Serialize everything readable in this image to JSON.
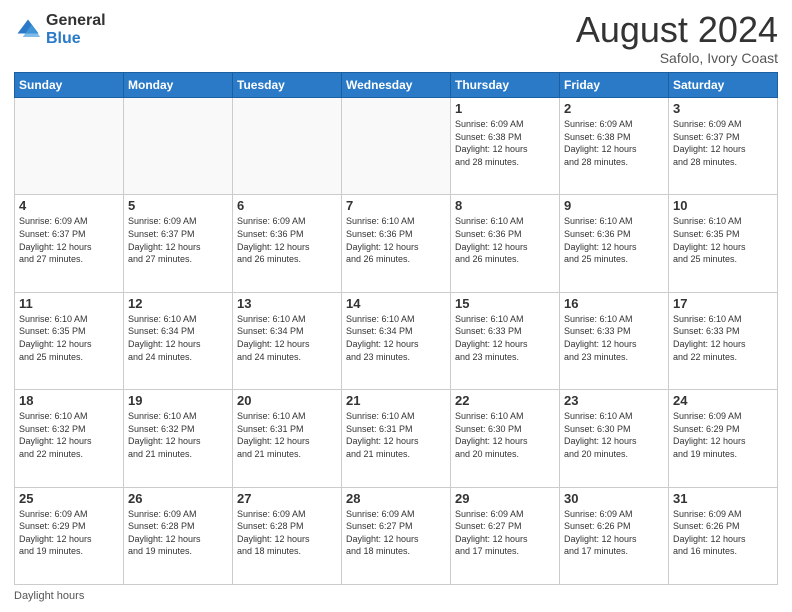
{
  "header": {
    "logo_general": "General",
    "logo_blue": "Blue",
    "month_title": "August 2024",
    "subtitle": "Safolo, Ivory Coast"
  },
  "footer": {
    "note": "Daylight hours"
  },
  "weekdays": [
    "Sunday",
    "Monday",
    "Tuesday",
    "Wednesday",
    "Thursday",
    "Friday",
    "Saturday"
  ],
  "weeks": [
    [
      {
        "day": "",
        "info": ""
      },
      {
        "day": "",
        "info": ""
      },
      {
        "day": "",
        "info": ""
      },
      {
        "day": "",
        "info": ""
      },
      {
        "day": "1",
        "info": "Sunrise: 6:09 AM\nSunset: 6:38 PM\nDaylight: 12 hours\nand 28 minutes."
      },
      {
        "day": "2",
        "info": "Sunrise: 6:09 AM\nSunset: 6:38 PM\nDaylight: 12 hours\nand 28 minutes."
      },
      {
        "day": "3",
        "info": "Sunrise: 6:09 AM\nSunset: 6:37 PM\nDaylight: 12 hours\nand 28 minutes."
      }
    ],
    [
      {
        "day": "4",
        "info": "Sunrise: 6:09 AM\nSunset: 6:37 PM\nDaylight: 12 hours\nand 27 minutes."
      },
      {
        "day": "5",
        "info": "Sunrise: 6:09 AM\nSunset: 6:37 PM\nDaylight: 12 hours\nand 27 minutes."
      },
      {
        "day": "6",
        "info": "Sunrise: 6:09 AM\nSunset: 6:36 PM\nDaylight: 12 hours\nand 26 minutes."
      },
      {
        "day": "7",
        "info": "Sunrise: 6:10 AM\nSunset: 6:36 PM\nDaylight: 12 hours\nand 26 minutes."
      },
      {
        "day": "8",
        "info": "Sunrise: 6:10 AM\nSunset: 6:36 PM\nDaylight: 12 hours\nand 26 minutes."
      },
      {
        "day": "9",
        "info": "Sunrise: 6:10 AM\nSunset: 6:36 PM\nDaylight: 12 hours\nand 25 minutes."
      },
      {
        "day": "10",
        "info": "Sunrise: 6:10 AM\nSunset: 6:35 PM\nDaylight: 12 hours\nand 25 minutes."
      }
    ],
    [
      {
        "day": "11",
        "info": "Sunrise: 6:10 AM\nSunset: 6:35 PM\nDaylight: 12 hours\nand 25 minutes."
      },
      {
        "day": "12",
        "info": "Sunrise: 6:10 AM\nSunset: 6:34 PM\nDaylight: 12 hours\nand 24 minutes."
      },
      {
        "day": "13",
        "info": "Sunrise: 6:10 AM\nSunset: 6:34 PM\nDaylight: 12 hours\nand 24 minutes."
      },
      {
        "day": "14",
        "info": "Sunrise: 6:10 AM\nSunset: 6:34 PM\nDaylight: 12 hours\nand 23 minutes."
      },
      {
        "day": "15",
        "info": "Sunrise: 6:10 AM\nSunset: 6:33 PM\nDaylight: 12 hours\nand 23 minutes."
      },
      {
        "day": "16",
        "info": "Sunrise: 6:10 AM\nSunset: 6:33 PM\nDaylight: 12 hours\nand 23 minutes."
      },
      {
        "day": "17",
        "info": "Sunrise: 6:10 AM\nSunset: 6:33 PM\nDaylight: 12 hours\nand 22 minutes."
      }
    ],
    [
      {
        "day": "18",
        "info": "Sunrise: 6:10 AM\nSunset: 6:32 PM\nDaylight: 12 hours\nand 22 minutes."
      },
      {
        "day": "19",
        "info": "Sunrise: 6:10 AM\nSunset: 6:32 PM\nDaylight: 12 hours\nand 21 minutes."
      },
      {
        "day": "20",
        "info": "Sunrise: 6:10 AM\nSunset: 6:31 PM\nDaylight: 12 hours\nand 21 minutes."
      },
      {
        "day": "21",
        "info": "Sunrise: 6:10 AM\nSunset: 6:31 PM\nDaylight: 12 hours\nand 21 minutes."
      },
      {
        "day": "22",
        "info": "Sunrise: 6:10 AM\nSunset: 6:30 PM\nDaylight: 12 hours\nand 20 minutes."
      },
      {
        "day": "23",
        "info": "Sunrise: 6:10 AM\nSunset: 6:30 PM\nDaylight: 12 hours\nand 20 minutes."
      },
      {
        "day": "24",
        "info": "Sunrise: 6:09 AM\nSunset: 6:29 PM\nDaylight: 12 hours\nand 19 minutes."
      }
    ],
    [
      {
        "day": "25",
        "info": "Sunrise: 6:09 AM\nSunset: 6:29 PM\nDaylight: 12 hours\nand 19 minutes."
      },
      {
        "day": "26",
        "info": "Sunrise: 6:09 AM\nSunset: 6:28 PM\nDaylight: 12 hours\nand 19 minutes."
      },
      {
        "day": "27",
        "info": "Sunrise: 6:09 AM\nSunset: 6:28 PM\nDaylight: 12 hours\nand 18 minutes."
      },
      {
        "day": "28",
        "info": "Sunrise: 6:09 AM\nSunset: 6:27 PM\nDaylight: 12 hours\nand 18 minutes."
      },
      {
        "day": "29",
        "info": "Sunrise: 6:09 AM\nSunset: 6:27 PM\nDaylight: 12 hours\nand 17 minutes."
      },
      {
        "day": "30",
        "info": "Sunrise: 6:09 AM\nSunset: 6:26 PM\nDaylight: 12 hours\nand 17 minutes."
      },
      {
        "day": "31",
        "info": "Sunrise: 6:09 AM\nSunset: 6:26 PM\nDaylight: 12 hours\nand 16 minutes."
      }
    ]
  ]
}
